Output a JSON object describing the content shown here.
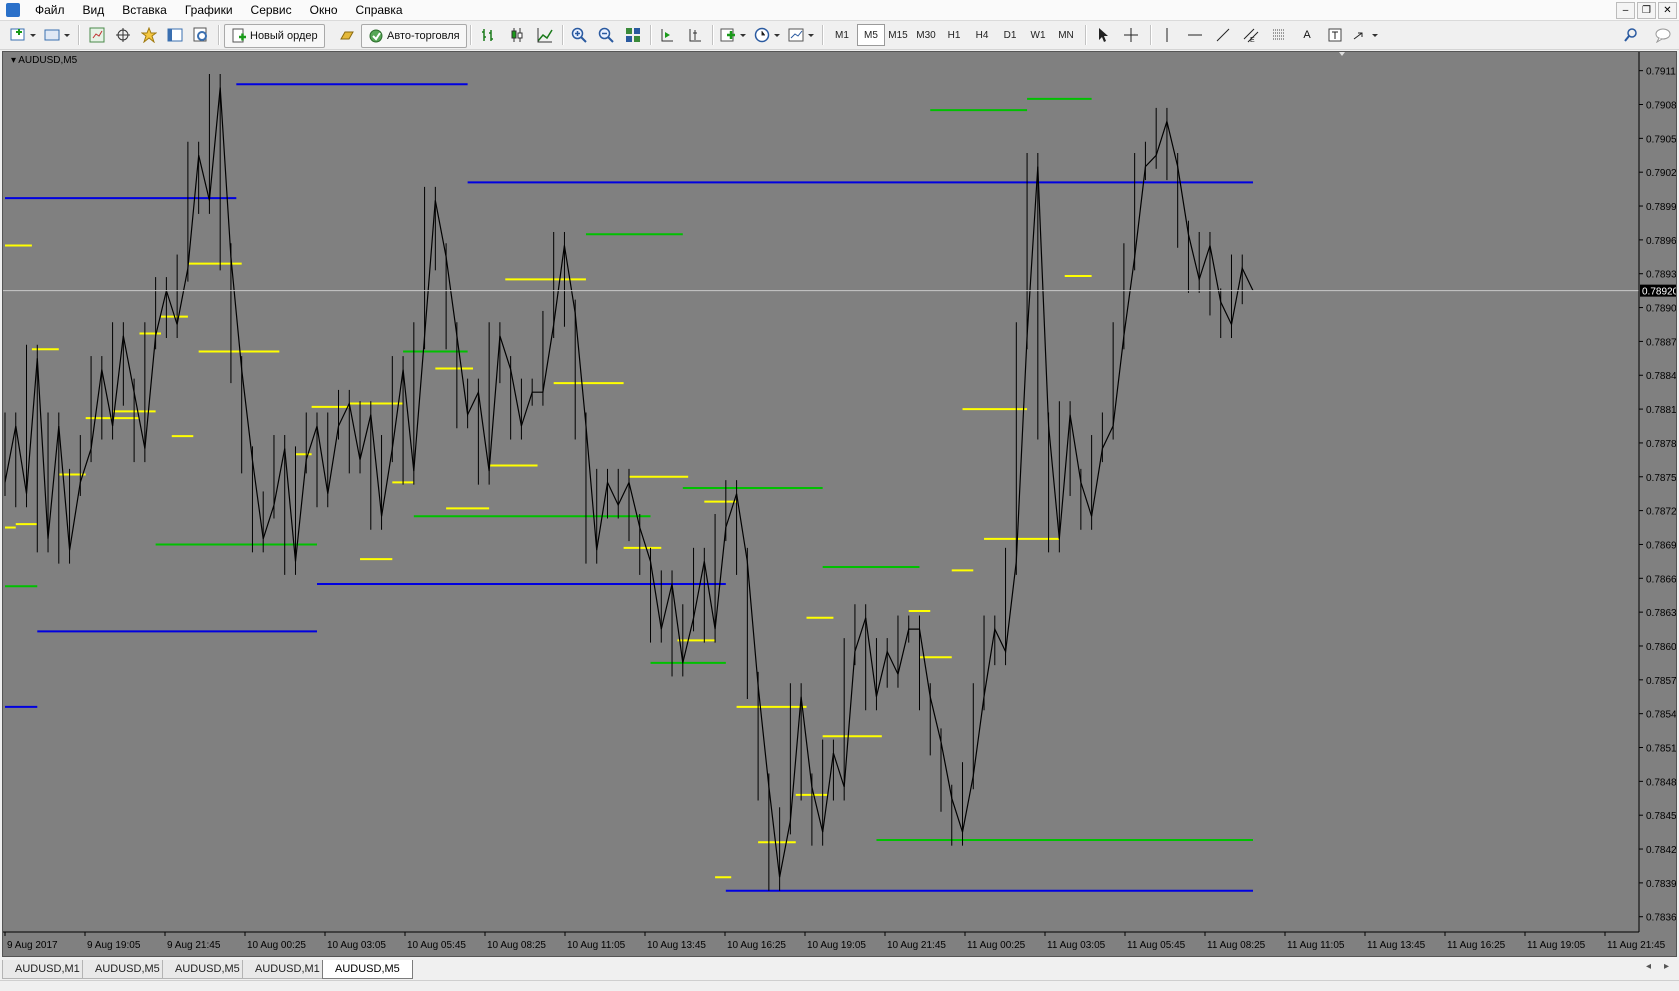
{
  "menu": {
    "items": [
      "Файл",
      "Вид",
      "Вставка",
      "Графики",
      "Сервис",
      "Окно",
      "Справка"
    ]
  },
  "toolbar": {
    "new_order": "Новый ордер",
    "auto_trading": "Авто-торговля",
    "timeframes": [
      "M1",
      "M5",
      "M15",
      "M30",
      "H1",
      "H4",
      "D1",
      "W1",
      "MN"
    ],
    "active_timeframe": "M5",
    "text_tool": "A"
  },
  "chart": {
    "title": "AUDUSD,M5",
    "current_price": "0.78920",
    "colors": {
      "background": "#808080",
      "price": "#000000",
      "blue_level": "#0000e0",
      "green_level": "#00c000",
      "yellow_level": "#ffff00"
    }
  },
  "chart_data": {
    "type": "line",
    "title": "AUDUSD,M5",
    "xlabel": "",
    "ylabel": "",
    "x_tick_labels": [
      "9 Aug 2017",
      "9 Aug 19:05",
      "9 Aug 21:45",
      "10 Aug 00:25",
      "10 Aug 03:05",
      "10 Aug 05:45",
      "10 Aug 08:25",
      "10 Aug 11:05",
      "10 Aug 13:45",
      "10 Aug 16:25",
      "10 Aug 19:05",
      "10 Aug 21:45",
      "11 Aug 00:25",
      "11 Aug 03:05",
      "11 Aug 05:45",
      "11 Aug 08:25",
      "11 Aug 11:05",
      "11 Aug 13:45",
      "11 Aug 16:25",
      "11 Aug 19:05",
      "11 Aug 21:45"
    ],
    "y_tick_labels": [
      "0.79115",
      "0.79085",
      "0.79055",
      "0.79025",
      "0.78995",
      "0.78965",
      "0.78935",
      "0.78905",
      "0.78875",
      "0.78845",
      "0.78815",
      "0.78785",
      "0.78755",
      "0.78725",
      "0.78695",
      "0.78665",
      "0.78635",
      "0.78605",
      "0.78575",
      "0.78545",
      "0.78515",
      "0.78485",
      "0.78455",
      "0.78425",
      "0.78395",
      "0.78365"
    ],
    "ylim": [
      0.78355,
      0.79128
    ],
    "current_price": 0.7892,
    "grid": false,
    "series": [
      {
        "values": [
          [
            0,
            0.7875
          ],
          [
            1,
            0.788
          ],
          [
            2,
            0.7874
          ],
          [
            3,
            0.7886
          ],
          [
            4,
            0.787
          ],
          [
            5,
            0.788
          ],
          [
            6,
            0.7869
          ],
          [
            7,
            0.7875
          ],
          [
            8,
            0.7878
          ],
          [
            9,
            0.7885
          ],
          [
            10,
            0.788
          ],
          [
            11,
            0.7888
          ],
          [
            12,
            0.7883
          ],
          [
            13,
            0.7878
          ],
          [
            14,
            0.7888
          ],
          [
            15,
            0.7892
          ],
          [
            16,
            0.7889
          ],
          [
            17,
            0.7894
          ],
          [
            18,
            0.7904
          ],
          [
            19,
            0.79
          ],
          [
            20,
            0.791
          ],
          [
            21,
            0.7895
          ],
          [
            22,
            0.7885
          ],
          [
            23,
            0.7877
          ],
          [
            24,
            0.787
          ],
          [
            25,
            0.7873
          ],
          [
            26,
            0.7878
          ],
          [
            27,
            0.7868
          ],
          [
            28,
            0.7877
          ],
          [
            29,
            0.788
          ],
          [
            30,
            0.7874
          ],
          [
            31,
            0.788
          ],
          [
            32,
            0.7882
          ],
          [
            33,
            0.7877
          ],
          [
            34,
            0.7881
          ],
          [
            35,
            0.7872
          ],
          [
            36,
            0.7878
          ],
          [
            37,
            0.7885
          ],
          [
            38,
            0.7876
          ],
          [
            39,
            0.7888
          ],
          [
            40,
            0.79
          ],
          [
            41,
            0.7895
          ],
          [
            42,
            0.7888
          ],
          [
            43,
            0.7881
          ],
          [
            44,
            0.7883
          ],
          [
            45,
            0.7876
          ],
          [
            46,
            0.7888
          ],
          [
            47,
            0.7885
          ],
          [
            48,
            0.788
          ],
          [
            49,
            0.7883
          ],
          [
            50,
            0.7883
          ],
          [
            51,
            0.7889
          ],
          [
            52,
            0.7896
          ],
          [
            53,
            0.789
          ],
          [
            54,
            0.788
          ],
          [
            55,
            0.7869
          ],
          [
            56,
            0.7875
          ],
          [
            57,
            0.7873
          ],
          [
            58,
            0.7875
          ],
          [
            59,
            0.7871
          ],
          [
            60,
            0.7868
          ],
          [
            61,
            0.7862
          ],
          [
            62,
            0.7866
          ],
          [
            63,
            0.7859
          ],
          [
            64,
            0.7863
          ],
          [
            65,
            0.7868
          ],
          [
            66,
            0.7862
          ],
          [
            67,
            0.7871
          ],
          [
            68,
            0.7874
          ],
          [
            69,
            0.7868
          ],
          [
            70,
            0.7857
          ],
          [
            71,
            0.7848
          ],
          [
            72,
            0.784
          ],
          [
            73,
            0.7845
          ],
          [
            74,
            0.7856
          ],
          [
            75,
            0.7848
          ],
          [
            76,
            0.7844
          ],
          [
            77,
            0.7851
          ],
          [
            78,
            0.7848
          ],
          [
            79,
            0.786
          ],
          [
            80,
            0.7863
          ],
          [
            81,
            0.7856
          ],
          [
            82,
            0.786
          ],
          [
            83,
            0.7858
          ],
          [
            84,
            0.7862
          ],
          [
            85,
            0.7862
          ],
          [
            86,
            0.7856
          ],
          [
            87,
            0.7852
          ],
          [
            88,
            0.7847
          ],
          [
            89,
            0.7844
          ],
          [
            90,
            0.7849
          ],
          [
            91,
            0.7856
          ],
          [
            92,
            0.7862
          ],
          [
            93,
            0.786
          ],
          [
            94,
            0.7868
          ],
          [
            95,
            0.7888
          ],
          [
            96,
            0.7903
          ],
          [
            97,
            0.788
          ],
          [
            98,
            0.787
          ],
          [
            99,
            0.7881
          ],
          [
            100,
            0.7875
          ],
          [
            101,
            0.7872
          ],
          [
            102,
            0.7878
          ],
          [
            103,
            0.788
          ],
          [
            104,
            0.7888
          ],
          [
            105,
            0.7895
          ],
          [
            106,
            0.7903
          ],
          [
            107,
            0.7904
          ],
          [
            108,
            0.7907
          ],
          [
            109,
            0.7903
          ],
          [
            110,
            0.7897
          ],
          [
            111,
            0.7893
          ],
          [
            112,
            0.7896
          ],
          [
            113,
            0.7891
          ],
          [
            114,
            0.7889
          ],
          [
            115,
            0.7894
          ],
          [
            116,
            0.7892
          ]
        ]
      }
    ],
    "levels": [
      {
        "color": "blue",
        "price": 0.79002,
        "x_from": 0.0,
        "x_to": 21.5
      },
      {
        "color": "blue",
        "price": 0.79103,
        "x_from": 21.5,
        "x_to": 43.0
      },
      {
        "color": "blue",
        "price": 0.79016,
        "x_from": 43.0,
        "x_to": 116.0
      },
      {
        "color": "blue",
        "price": 0.78618,
        "x_from": 3.0,
        "x_to": 29.0
      },
      {
        "color": "blue",
        "price": 0.7866,
        "x_from": 29.0,
        "x_to": 67.0
      },
      {
        "color": "blue",
        "price": 0.78551,
        "x_from": 0.0,
        "x_to": 3.0
      },
      {
        "color": "blue",
        "price": 0.78388,
        "x_from": 67.0,
        "x_to": 116.0
      },
      {
        "color": "green",
        "price": 0.78695,
        "x_from": 14.0,
        "x_to": 29.0
      },
      {
        "color": "green",
        "price": 0.78866,
        "x_from": 37.0,
        "x_to": 43.0
      },
      {
        "color": "green",
        "price": 0.7872,
        "x_from": 38.0,
        "x_to": 60.0
      },
      {
        "color": "green",
        "price": 0.7897,
        "x_from": 54.0,
        "x_to": 63.0
      },
      {
        "color": "green",
        "price": 0.78745,
        "x_from": 63.0,
        "x_to": 76.0
      },
      {
        "color": "green",
        "price": 0.7859,
        "x_from": 60.0,
        "x_to": 67.0
      },
      {
        "color": "green",
        "price": 0.78675,
        "x_from": 76.0,
        "x_to": 85.0
      },
      {
        "color": "green",
        "price": 0.78433,
        "x_from": 81.0,
        "x_to": 116.0
      },
      {
        "color": "green",
        "price": 0.7908,
        "x_from": 86.0,
        "x_to": 95.0
      },
      {
        "color": "green",
        "price": 0.7909,
        "x_from": 95.0,
        "x_to": 101.0
      },
      {
        "color": "green",
        "price": 0.78658,
        "x_from": 0.0,
        "x_to": 3.0
      },
      {
        "color": "yellow",
        "price": 0.7896,
        "x_from": 0.0,
        "x_to": 2.5
      },
      {
        "color": "yellow",
        "price": 0.78868,
        "x_from": 2.5,
        "x_to": 5.0
      },
      {
        "color": "yellow",
        "price": 0.7871,
        "x_from": 0.0,
        "x_to": 1.0
      },
      {
        "color": "yellow",
        "price": 0.78713,
        "x_from": 1.0,
        "x_to": 3.0
      },
      {
        "color": "yellow",
        "price": 0.78757,
        "x_from": 5.0,
        "x_to": 7.5
      },
      {
        "color": "yellow",
        "price": 0.78807,
        "x_from": 7.5,
        "x_to": 12.5
      },
      {
        "color": "yellow",
        "price": 0.78813,
        "x_from": 10.0,
        "x_to": 14.0
      },
      {
        "color": "yellow",
        "price": 0.78882,
        "x_from": 12.5,
        "x_to": 14.5
      },
      {
        "color": "yellow",
        "price": 0.78791,
        "x_from": 15.5,
        "x_to": 17.5
      },
      {
        "color": "yellow",
        "price": 0.78897,
        "x_from": 14.5,
        "x_to": 17.0
      },
      {
        "color": "yellow",
        "price": 0.78944,
        "x_from": 17.0,
        "x_to": 22.0
      },
      {
        "color": "yellow",
        "price": 0.78866,
        "x_from": 18.0,
        "x_to": 25.5
      },
      {
        "color": "yellow",
        "price": 0.78775,
        "x_from": 27.0,
        "x_to": 28.5
      },
      {
        "color": "yellow",
        "price": 0.78817,
        "x_from": 28.5,
        "x_to": 32.0
      },
      {
        "color": "yellow",
        "price": 0.7882,
        "x_from": 32.0,
        "x_to": 37.0
      },
      {
        "color": "yellow",
        "price": 0.78682,
        "x_from": 33.0,
        "x_to": 36.0
      },
      {
        "color": "yellow",
        "price": 0.7875,
        "x_from": 36.0,
        "x_to": 38.0
      },
      {
        "color": "yellow",
        "price": 0.78851,
        "x_from": 40.0,
        "x_to": 43.5
      },
      {
        "color": "yellow",
        "price": 0.78727,
        "x_from": 41.0,
        "x_to": 45.0
      },
      {
        "color": "yellow",
        "price": 0.7893,
        "x_from": 46.5,
        "x_to": 54.0
      },
      {
        "color": "yellow",
        "price": 0.78765,
        "x_from": 45.0,
        "x_to": 49.5
      },
      {
        "color": "yellow",
        "price": 0.78838,
        "x_from": 51.0,
        "x_to": 57.5
      },
      {
        "color": "yellow",
        "price": 0.78755,
        "x_from": 58.0,
        "x_to": 63.5
      },
      {
        "color": "yellow",
        "price": 0.78692,
        "x_from": 57.5,
        "x_to": 61.0
      },
      {
        "color": "yellow",
        "price": 0.7861,
        "x_from": 62.5,
        "x_to": 66.0
      },
      {
        "color": "yellow",
        "price": 0.78733,
        "x_from": 65.0,
        "x_to": 68.0
      },
      {
        "color": "yellow",
        "price": 0.784,
        "x_from": 66.0,
        "x_to": 67.5
      },
      {
        "color": "yellow",
        "price": 0.78551,
        "x_from": 68.0,
        "x_to": 74.5
      },
      {
        "color": "yellow",
        "price": 0.78431,
        "x_from": 70.0,
        "x_to": 73.5
      },
      {
        "color": "yellow",
        "price": 0.78473,
        "x_from": 73.5,
        "x_to": 76.5
      },
      {
        "color": "yellow",
        "price": 0.7863,
        "x_from": 74.5,
        "x_to": 77.0
      },
      {
        "color": "yellow",
        "price": 0.78525,
        "x_from": 76.0,
        "x_to": 81.5
      },
      {
        "color": "yellow",
        "price": 0.78636,
        "x_from": 84.0,
        "x_to": 86.0
      },
      {
        "color": "yellow",
        "price": 0.78595,
        "x_from": 85.0,
        "x_to": 88.0
      },
      {
        "color": "yellow",
        "price": 0.78672,
        "x_from": 88.0,
        "x_to": 90.0
      },
      {
        "color": "yellow",
        "price": 0.78815,
        "x_from": 89.0,
        "x_to": 95.0
      },
      {
        "color": "yellow",
        "price": 0.787,
        "x_from": 91.0,
        "x_to": 98.0
      },
      {
        "color": "yellow",
        "price": 0.78933,
        "x_from": 98.5,
        "x_to": 101.0
      }
    ]
  },
  "tabs": [
    "AUDUSD,M1",
    "AUDUSD,M5",
    "AUDUSD,M5",
    "AUDUSD,M1",
    "AUDUSD,M5"
  ],
  "active_tab": 4
}
